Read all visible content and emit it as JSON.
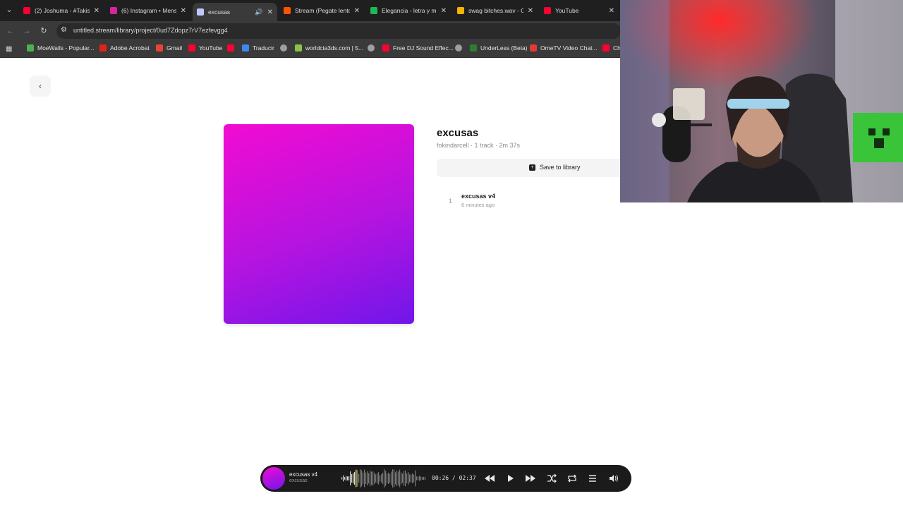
{
  "browser": {
    "tabs": [
      {
        "title": "(2) Joshuma - #Takist",
        "icon": "youtube-icon",
        "color": "#ff0033",
        "active": false
      },
      {
        "title": "(6) Instagram • Mens",
        "icon": "instagram-icon",
        "color": "#d6249f",
        "active": false
      },
      {
        "title": "excusas",
        "icon": "globe-icon",
        "color": "#c0c8ff",
        "active": true,
        "audible": true
      },
      {
        "title": "Stream (Pegate lento",
        "icon": "soundcloud-icon",
        "color": "#ff5500",
        "active": false
      },
      {
        "title": "Elegancia - letra y m",
        "icon": "spotify-icon",
        "color": "#1db954",
        "active": false
      },
      {
        "title": "swag bitches.wav - G",
        "icon": "drive-icon",
        "color": "#f4b400",
        "active": false
      },
      {
        "title": "YouTube",
        "icon": "youtube-icon",
        "color": "#ff0033",
        "active": false
      }
    ],
    "url": "untitled.stream/library/project/0ud7Zdopz7rV7ezfevgg4",
    "bookmarks": [
      {
        "label": "MoeWalls - Popular...",
        "icon": "moewalls-icon",
        "color": "#4caf50"
      },
      {
        "label": "Adobe Acrobat",
        "icon": "acrobat-icon",
        "color": "#e2231a"
      },
      {
        "label": "Gmail",
        "icon": "gmail-icon",
        "color": "#ea4335"
      },
      {
        "label": "YouTube",
        "icon": "youtube-icon",
        "color": "#ff0033"
      },
      {
        "label": "",
        "icon": "youtube-icon",
        "color": "#ff0033"
      },
      {
        "label": "Traducir",
        "icon": "translate-icon",
        "color": "#4285f4"
      },
      {
        "label": "",
        "icon": "globe-icon",
        "color": "#9e9e9e"
      },
      {
        "label": "worldcia3ds.com | 5...",
        "icon": "worldcia-icon",
        "color": "#8bc34a"
      },
      {
        "label": "",
        "icon": "globe-icon",
        "color": "#9e9e9e"
      },
      {
        "label": "Free DJ Sound Effec...",
        "icon": "youtube-icon",
        "color": "#ff0033"
      },
      {
        "label": "",
        "icon": "globe-icon",
        "color": "#9e9e9e"
      },
      {
        "label": "UnderLess (Beta)",
        "icon": "underless-icon",
        "color": "#2e7d32"
      },
      {
        "label": "OmeTV Video Chat...",
        "icon": "ometv-icon",
        "color": "#e53935"
      },
      {
        "label": "Ch",
        "icon": "youtube-icon",
        "color": "#ff0033"
      }
    ]
  },
  "page": {
    "back_label": "‹",
    "project": {
      "title": "excusas",
      "meta": "fokindarcell · 1 track · 2m 37s",
      "save_label": "Save to library"
    },
    "tracks": [
      {
        "number": "1",
        "name": "excusas v4",
        "time": "6 minutes ago"
      }
    ]
  },
  "player": {
    "title": "excusas v4",
    "subtitle": "excusas",
    "elapsed": "00:26",
    "separator": "/",
    "duration": "02:37",
    "progress": 0.166
  },
  "colors": {
    "cover_top": "#f20bd2",
    "cover_bottom": "#7016ea",
    "player_bg": "#1b1b1b",
    "progress_marker": "#e8d84a"
  }
}
